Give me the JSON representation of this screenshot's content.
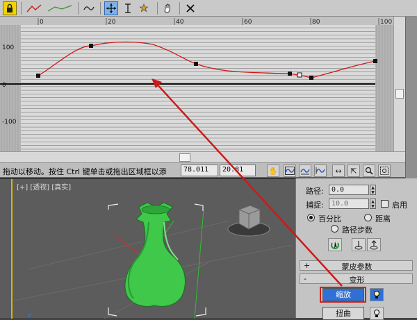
{
  "toolbar": {
    "icons": [
      "lock-icon",
      "curve-color-icon",
      "swap-curves-icon",
      "move-control-point-icon",
      "scale-control-point-icon",
      "insert-corner-point-icon",
      "reset-curves-icon",
      "delete-control-point-icon"
    ]
  },
  "curve_editor": {
    "x_ticks": [
      "0",
      "20",
      "40",
      "60",
      "80",
      "100"
    ],
    "y_ticks": [
      "100",
      "0",
      "-100"
    ],
    "curve_color": "#cc1a1a",
    "arrow_color": "#cc1a1a"
  },
  "statusbar": {
    "message": "拖动以移动。按住 Ctrl 键单击或拖出区域框以添",
    "x_value": "78.011",
    "y_value": "20.81",
    "icons": [
      "pan-icon",
      "zoom-extents-icon",
      "zoom-horizontal-extents-icon",
      "zoom-value-extents-icon",
      "zoom-icon",
      "zoom-horizontal-icon",
      "zoom-vertical-icon",
      "zoom-region-icon"
    ]
  },
  "viewport": {
    "label": "[+] [透视] [真实]"
  },
  "panel": {
    "path_label": "路径:",
    "path_value": "0.0",
    "snap_label": "捕捉:",
    "snap_value": "10.0",
    "enable_label": "启用",
    "percent_label": "百分比",
    "distance_label": "距离",
    "path_steps_label": "路径步数",
    "skin_params_label": "蒙皮参数",
    "deform_label": "变形",
    "scale_label": "缩放",
    "twist_label": "扭曲",
    "expand_sign": "+",
    "collapse_sign": "-",
    "accent_color": "#2f6fd6",
    "highlight_color": "#d02020"
  }
}
